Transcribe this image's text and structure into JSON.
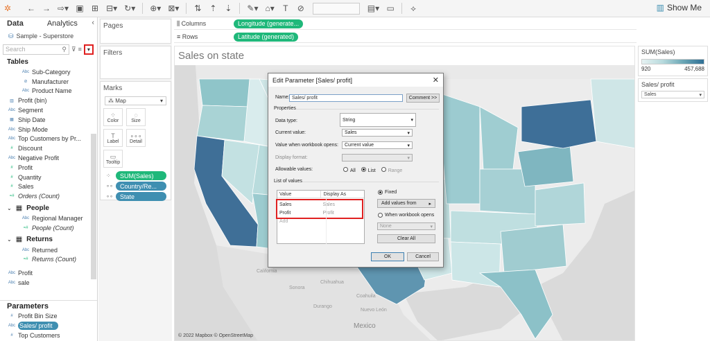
{
  "toolbar": {
    "show_me": "Show Me"
  },
  "data_pane": {
    "tab_data": "Data",
    "tab_analytics": "Analytics",
    "datasource": "Sample - Superstore",
    "search_placeholder": "Search",
    "tables_header": "Tables",
    "fields": [
      {
        "type": "Abc",
        "label": "Sub-Category",
        "indent": 2
      },
      {
        "type": "⊘",
        "label": "Manufacturer",
        "indent": 2
      },
      {
        "type": "Abc",
        "label": "Product Name",
        "indent": 2
      },
      {
        "type": "▥",
        "label": "Profit (bin)",
        "indent": 1
      },
      {
        "type": "Abc",
        "label": "Segment",
        "indent": 1
      },
      {
        "type": "▦",
        "label": "Ship Date",
        "indent": 1
      },
      {
        "type": "Abc",
        "label": "Ship Mode",
        "indent": 1
      },
      {
        "type": "Abc",
        "label": "Top Customers by Pr...",
        "indent": 1
      },
      {
        "type": "#",
        "label": "Discount",
        "indent": 1
      },
      {
        "type": "Abc",
        "label": "Negative Profit",
        "indent": 1
      },
      {
        "type": "#",
        "label": "Profit",
        "indent": 1
      },
      {
        "type": "#",
        "label": "Quantity",
        "indent": 1
      },
      {
        "type": "#",
        "label": "Sales",
        "indent": 1
      },
      {
        "type": "=#",
        "label": "Orders (Count)",
        "indent": 1,
        "italic": true
      }
    ],
    "people_header": "People",
    "people_fields": [
      {
        "type": "Abc",
        "label": "Regional Manager"
      },
      {
        "type": "=#",
        "label": "People (Count)",
        "italic": true
      }
    ],
    "returns_header": "Returns",
    "returns_fields": [
      {
        "type": "Abc",
        "label": "Returned"
      },
      {
        "type": "=#",
        "label": "Returns (Count)",
        "italic": true
      }
    ],
    "extra_fields": [
      {
        "type": "Abc",
        "label": "Profit"
      },
      {
        "type": "Abc",
        "label": "sale"
      }
    ],
    "parameters_header": "Parameters",
    "parameters": [
      {
        "type": "#",
        "label": "Profit Bin Size"
      },
      {
        "type": "Abc",
        "label": "Sales/ profit",
        "selected": true
      },
      {
        "type": "#",
        "label": "Top Customers"
      }
    ]
  },
  "cards": {
    "pages": "Pages",
    "filters": "Filters",
    "marks": "Marks",
    "marks_type": "Map",
    "mark_buttons": [
      {
        "icon": "⁘",
        "label": "Color"
      },
      {
        "icon": "◌",
        "label": "Size"
      },
      {
        "icon": "T",
        "label": "Label"
      },
      {
        "icon": "∘∘∘",
        "label": "Detail"
      },
      {
        "icon": "▭",
        "label": "Tooltip"
      }
    ],
    "mark_pills": [
      {
        "label": "SUM(Sales)",
        "color": "green"
      },
      {
        "label": "Country/Re...",
        "color": "blue"
      },
      {
        "label": "State",
        "color": "blue"
      }
    ]
  },
  "shelves": {
    "columns_label": "Columns",
    "columns_pill": "Longitude (generate...",
    "rows_label": "Rows",
    "rows_pill": "Latitude (generated)"
  },
  "view": {
    "title": "Sales on state",
    "credit": "© 2022 Mapbox © OpenStreetMap",
    "labels": [
      "Mexico",
      "California",
      "Chihuahua",
      "Sonora",
      "Durango",
      "Coahuila",
      "Nuevo León"
    ]
  },
  "legend": {
    "title": "SUM(Sales)",
    "min": "920",
    "max": "457,688",
    "colors": [
      "#e6f2f2",
      "#b8dadd",
      "#6aa6b5",
      "#2f6f95"
    ]
  },
  "param_card": {
    "title": "Sales/ profit",
    "value": "Sales"
  },
  "dialog": {
    "title": "Edit Parameter [Sales/ profit]",
    "name_label": "Name:",
    "name_value": "Sales/ profit",
    "comment_btn": "Comment >>",
    "properties": "Properties",
    "data_type_label": "Data type:",
    "data_type_value": "String",
    "current_value_label": "Current value:",
    "current_value": "Sales",
    "when_opens_label": "Value when workbook opens:",
    "when_opens_value": "Current value",
    "display_format_label": "Display format:",
    "allowable_label": "Allowable values:",
    "allowable_options": [
      "All",
      "List",
      "Range"
    ],
    "list_of_values": "List of values",
    "col_value": "Value",
    "col_display": "Display As",
    "rows": [
      {
        "value": "Sales",
        "display": "Sales"
      },
      {
        "value": "Profit",
        "display": "Profit"
      }
    ],
    "add_row": "Add",
    "fixed": "Fixed",
    "add_values_from": "Add values from",
    "when_workbook_opens": "When workbook opens",
    "none": "None",
    "clear_all": "Clear All",
    "ok": "OK",
    "cancel": "Cancel"
  }
}
